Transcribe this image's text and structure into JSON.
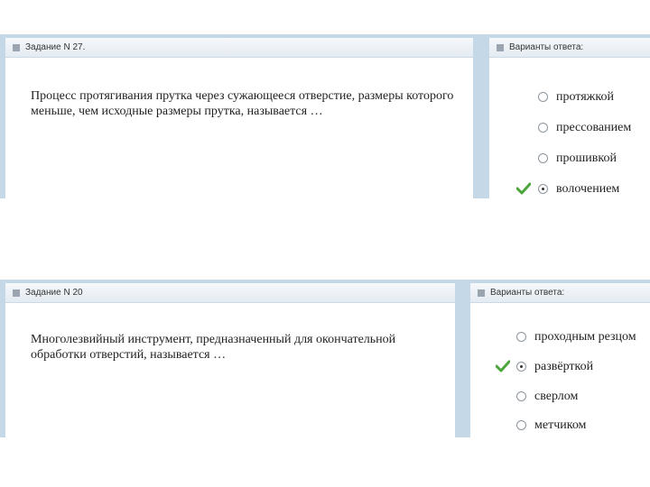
{
  "q1": {
    "header": "Задание N 27.",
    "question": "Процесс протягивания прутка через сужающееся отверстие, размеры которого меньше, чем исходные размеры прутка, называется …",
    "answers_header": "Варианты ответа:",
    "options": [
      {
        "label": "протяжкой",
        "selected": false
      },
      {
        "label": "прессованием",
        "selected": false
      },
      {
        "label": "прошивкой",
        "selected": false
      },
      {
        "label": "волочением",
        "selected": true
      }
    ]
  },
  "q2": {
    "header": "Задание N 20",
    "question": "Многолезвийный инструмент, предназначенный для окончательной обработки отверстий, называется …",
    "answers_header": "Варианты ответа:",
    "options": [
      {
        "label": "проходным резцом",
        "selected": false
      },
      {
        "label": "развёрткой",
        "selected": true
      },
      {
        "label": "сверлом",
        "selected": false
      },
      {
        "label": "метчиком",
        "selected": false
      }
    ]
  },
  "colors": {
    "panel_bg": "#c5d8e8",
    "check": "#4aa53a"
  }
}
